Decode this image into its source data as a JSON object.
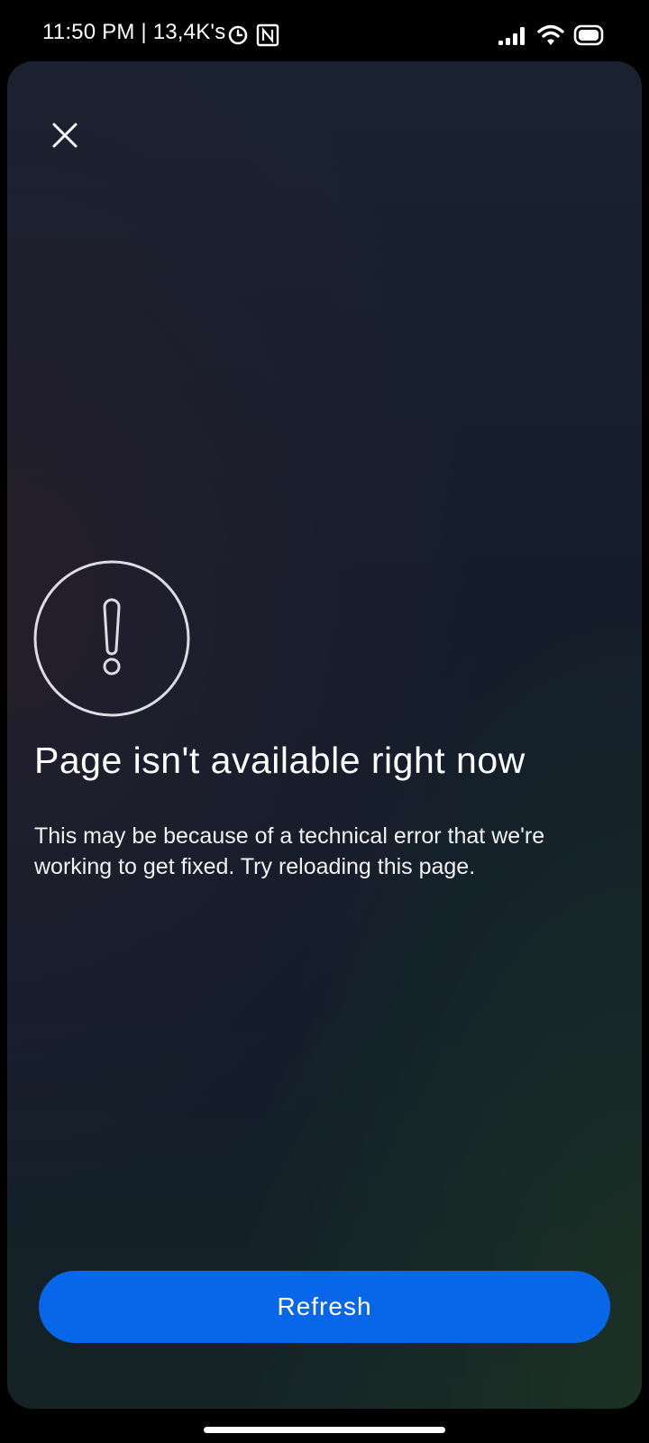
{
  "status_bar": {
    "text": "11:50 PM | 13,4K's",
    "left_icons": [
      "alarm-icon",
      "nfc-icon"
    ],
    "right_icons": [
      "signal-icon",
      "wifi-icon",
      "battery-icon"
    ]
  },
  "dialog": {
    "close_icon": "close-icon",
    "alert_icon": "exclamation-circle-icon",
    "title": "Page isn't available right now",
    "message": "This may be because of a technical error that we're working to get fixed. Try reloading this page.",
    "refresh_label": "Refresh"
  },
  "colors": {
    "accent": "#0866e8",
    "background": "#141d2b",
    "text": "#ffffff"
  }
}
